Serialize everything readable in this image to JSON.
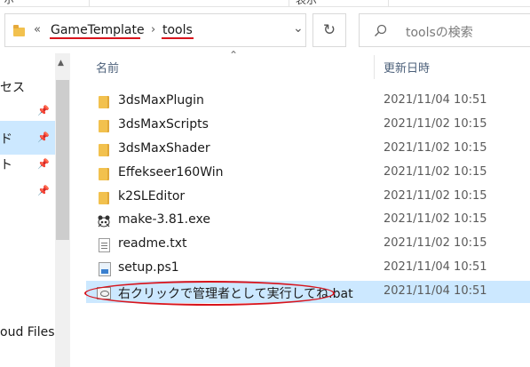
{
  "ribbon": {
    "fragments": [
      "ホ",
      "表示"
    ]
  },
  "address_bar": {
    "separator_left": "«",
    "crumbs": [
      "GameTemplate",
      "tools"
    ],
    "separator": "›",
    "dropdown_glyph": "⌄",
    "refresh_glyph": "↻"
  },
  "search": {
    "placeholder": "toolsの検索"
  },
  "nav": {
    "items": [
      "セス",
      "ド",
      "ト",
      "oud Files"
    ],
    "pin_glyph": "📌"
  },
  "columns": {
    "name": "名前",
    "date": "更新日時",
    "sort_glyph": "⌃"
  },
  "files": [
    {
      "name": "3dsMaxPlugin",
      "date": "2021/11/04 10:51",
      "type": "folder"
    },
    {
      "name": "3dsMaxScripts",
      "date": "2021/11/02 10:15",
      "type": "folder"
    },
    {
      "name": "3dsMaxShader",
      "date": "2021/11/02 10:15",
      "type": "folder"
    },
    {
      "name": "Effekseer160Win",
      "date": "2021/11/02 10:15",
      "type": "folder"
    },
    {
      "name": "k2SLEditor",
      "date": "2021/11/02 10:15",
      "type": "folder"
    },
    {
      "name": "make-3.81.exe",
      "date": "2021/11/02 10:15",
      "type": "exe"
    },
    {
      "name": "readme.txt",
      "date": "2021/11/02 10:15",
      "type": "txt"
    },
    {
      "name": "setup.ps1",
      "date": "2021/11/04 10:51",
      "type": "ps1"
    },
    {
      "name": "右クリックで管理者として実行してね.bat",
      "date": "2021/11/04 10:51",
      "type": "bat",
      "selected": true
    }
  ],
  "colors": {
    "selection": "#cce8ff",
    "annotation": "#d8141c",
    "folder": "#f2c14e"
  }
}
